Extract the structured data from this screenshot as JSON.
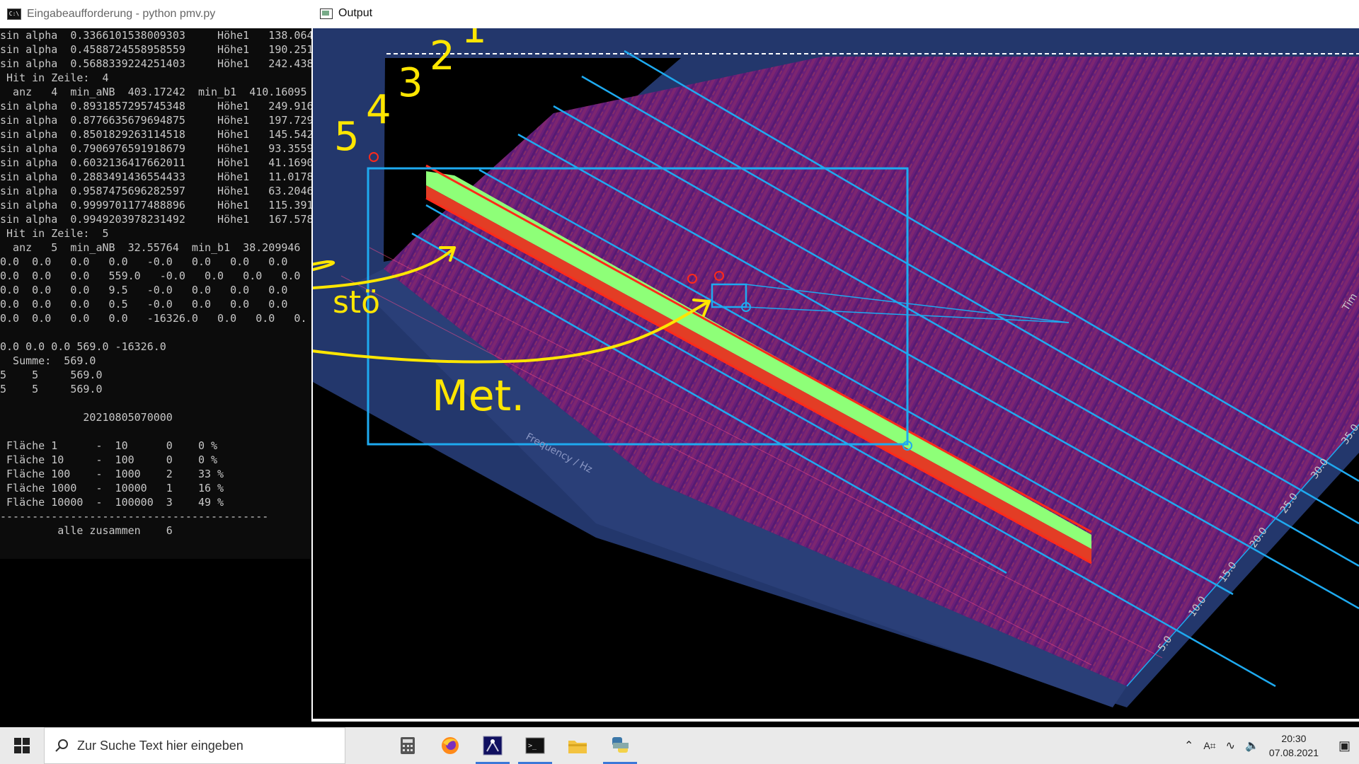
{
  "console": {
    "title": "Eingabeaufforderung - python pmv.py",
    "lines": [
      "sin alpha  0.3366101538009303     Höhe1   138.064",
      "sin alpha  0.4588724558958559     Höhe1   190.251",
      "sin alpha  0.5688339224251403     Höhe1   242.438",
      " Hit in Zeile:  4",
      "  anz   4  min_aNB  403.17242  min_b1  410.16095",
      "sin alpha  0.8931857295745348     Höhe1   249.916",
      "sin alpha  0.8776635679694875     Höhe1   197.729",
      "sin alpha  0.8501829263114518     Höhe1   145.542",
      "sin alpha  0.7906976591918679     Höhe1   93.3559",
      "sin alpha  0.6032136417662011     Höhe1   41.1690",
      "sin alpha  0.2883491436554433     Höhe1   11.0178",
      "sin alpha  0.9587475696282597     Höhe1   63.2046",
      "sin alpha  0.9999701177488896     Höhe1   115.391",
      "sin alpha  0.9949203978231492     Höhe1   167.578",
      " Hit in Zeile:  5",
      "  anz   5  min_aNB  32.55764  min_b1  38.209946",
      "0.0  0.0   0.0   0.0   -0.0   0.0   0.0   0.0",
      "0.0  0.0   0.0   559.0   -0.0   0.0   0.0   0.0",
      "0.0  0.0   0.0   9.5   -0.0   0.0   0.0   0.0",
      "0.0  0.0   0.0   0.5   -0.0   0.0   0.0   0.0",
      "0.0  0.0   0.0   0.0   -16326.0   0.0   0.0   0.",
      "",
      "0.0 0.0 0.0 569.0 -16326.0",
      "  Summe:  569.0",
      "5    5     569.0",
      "5    5     569.0",
      "",
      "             20210805070000",
      "",
      " Fläche 1      -  10      0    0 %",
      " Fläche 10     -  100     0    0 %",
      " Fläche 100    -  1000    2    33 %",
      " Fläche 1000   -  10000   1    16 %",
      " Fläche 10000  -  100000  3    49 %",
      "------------------------------------------",
      "         alle zusammen    6"
    ]
  },
  "output": {
    "title": "Output",
    "axis_freq_label": "Frequency / Hz",
    "axis_time_label": "Tim",
    "time_ticks": [
      "5.0",
      "10.0",
      "15.0",
      "20.0",
      "25.0",
      "30.0",
      "35.0"
    ],
    "annotations": {
      "numbers": [
        "5",
        "4",
        "3",
        "2",
        "1"
      ],
      "stoe": "stö",
      "met": "Met."
    },
    "colors": {
      "background_plate": "#2a3f78",
      "spectrum_purple": "#6b1d7a",
      "signal_green": "#8eff78",
      "signal_red": "#ff2a1a",
      "guide_blue": "#1eaaf0",
      "annotation_yellow": "#ffe600"
    }
  },
  "taskbar": {
    "search_placeholder": "Zur Suche Text hier eingeben",
    "apps": [
      "calculator-icon",
      "firefox-icon",
      "astro-app-icon",
      "terminal-icon",
      "file-explorer-icon",
      "python-icon"
    ],
    "time": "20:30",
    "date": "07.08.2021"
  }
}
